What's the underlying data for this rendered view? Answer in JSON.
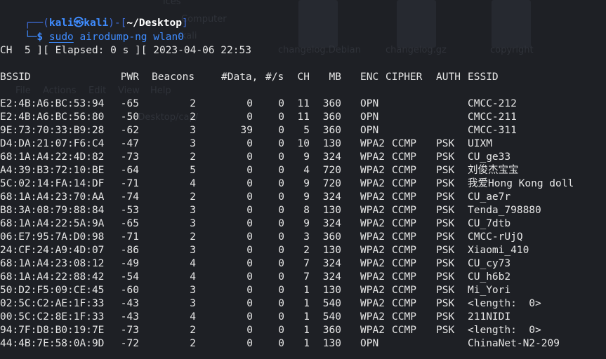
{
  "background_ghosts": {
    "icons_label": "ices",
    "computer": "Computer",
    "kali": "kali",
    "changelog_debian": "changelog.Debian",
    "changelog_gz": "changelog.gz",
    "copyright": "copyright",
    "menu_file": "File",
    "menu_actions": "Actions",
    "menu_edit": "Edit",
    "menu_view": "View",
    "menu_help": "Help",
    "path_fragment": "/Desktop/cap/"
  },
  "prompt": {
    "corner_top": "┌──(",
    "user": "kali",
    "at": "㉿",
    "host": "kali",
    "sep": ")-[",
    "path": "~/Desktop",
    "close": "]",
    "corner_bottom": "└─$",
    "cmd_sudo": "sudo",
    "cmd_rest": " airodump-ng wlan0"
  },
  "status_line": "CH  5 ][ Elapsed: 0 s ][ 2023-04-06 22:53",
  "headers": [
    "BSSID",
    "PWR",
    "Beacons",
    "#Data,",
    "#/s",
    "CH",
    "MB",
    "ENC",
    "CIPHER",
    "AUTH",
    "ESSID"
  ],
  "rows": [
    [
      "E2:4B:A6:BC:53:94",
      "-65",
      "2",
      "0",
      "0",
      "11",
      "360",
      "OPN",
      "",
      "",
      "CMCC-212"
    ],
    [
      "E2:4B:A6:BC:56:80",
      "-50",
      "2",
      "0",
      "0",
      "11",
      "360",
      "OPN",
      "",
      "",
      "CMCC-211"
    ],
    [
      "9E:73:70:33:B9:28",
      "-62",
      "3",
      "39",
      "0",
      "5",
      "360",
      "OPN",
      "",
      "",
      "CMCC-311"
    ],
    [
      "D4:DA:21:07:F6:C4",
      "-47",
      "3",
      "0",
      "0",
      "10",
      "130",
      "WPA2",
      "CCMP",
      "PSK",
      "UIXM"
    ],
    [
      "68:1A:A4:22:4D:82",
      "-73",
      "2",
      "0",
      "0",
      "9",
      "324",
      "WPA2",
      "CCMP",
      "PSK",
      "CU_ge33"
    ],
    [
      "A4:39:B3:72:10:BE",
      "-64",
      "5",
      "0",
      "0",
      "4",
      "720",
      "WPA2",
      "CCMP",
      "PSK",
      "刘俊杰宝宝"
    ],
    [
      "5C:02:14:FA:14:DF",
      "-71",
      "4",
      "0",
      "0",
      "9",
      "720",
      "WPA2",
      "CCMP",
      "PSK",
      "我爱Hong Kong doll"
    ],
    [
      "68:1A:A4:23:70:AA",
      "-74",
      "2",
      "0",
      "0",
      "9",
      "324",
      "WPA2",
      "CCMP",
      "PSK",
      "CU_ae7r"
    ],
    [
      "B8:3A:08:79:88:84",
      "-53",
      "3",
      "0",
      "0",
      "8",
      "130",
      "WPA2",
      "CCMP",
      "PSK",
      "Tenda_798880"
    ],
    [
      "68:1A:A4:22:5A:9A",
      "-65",
      "3",
      "0",
      "0",
      "9",
      "324",
      "WPA2",
      "CCMP",
      "PSK",
      "CU_7dtb"
    ],
    [
      "06:E7:95:7A:D0:98",
      "-71",
      "2",
      "0",
      "0",
      "3",
      "360",
      "WPA2",
      "CCMP",
      "PSK",
      "CMCC-rUjQ"
    ],
    [
      "24:CF:24:A9:4D:07",
      "-86",
      "3",
      "0",
      "0",
      "2",
      "130",
      "WPA2",
      "CCMP",
      "PSK",
      "Xiaomi_410"
    ],
    [
      "68:1A:A4:23:08:12",
      "-49",
      "4",
      "0",
      "0",
      "7",
      "324",
      "WPA2",
      "CCMP",
      "PSK",
      "CU_cy73"
    ],
    [
      "68:1A:A4:22:88:42",
      "-54",
      "4",
      "0",
      "0",
      "7",
      "324",
      "WPA2",
      "CCMP",
      "PSK",
      "CU_h6b2"
    ],
    [
      "50:D2:F5:09:CE:45",
      "-60",
      "3",
      "0",
      "0",
      "1",
      "130",
      "WPA2",
      "CCMP",
      "PSK",
      "Mi_Yori"
    ],
    [
      "02:5C:C2:AE:1F:33",
      "-43",
      "3",
      "0",
      "0",
      "1",
      "540",
      "WPA2",
      "CCMP",
      "PSK",
      "<length:  0>"
    ],
    [
      "00:5C:C2:8E:1F:33",
      "-43",
      "4",
      "0",
      "0",
      "1",
      "540",
      "WPA2",
      "CCMP",
      "PSK",
      "211NIDI"
    ],
    [
      "94:7F:D8:B0:19:7E",
      "-73",
      "2",
      "0",
      "0",
      "1",
      "360",
      "WPA2",
      "CCMP",
      "PSK",
      "<length:  0>"
    ],
    [
      "44:4B:7E:58:0A:9D",
      "-72",
      "2",
      "0",
      "0",
      "1",
      "130",
      "OPN",
      "",
      "",
      "ChinaNet-N2-209"
    ]
  ],
  "colors": {
    "background": "#1e2025",
    "prompt_blue": "#3f8cff",
    "text": "#e6e6e6"
  }
}
